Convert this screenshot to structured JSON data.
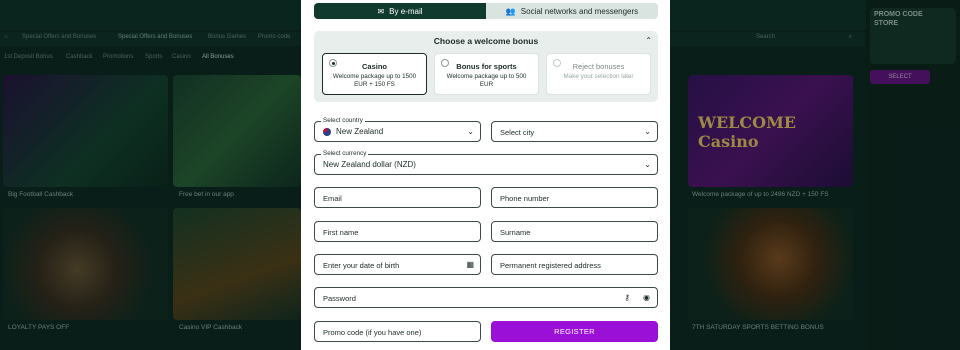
{
  "background": {
    "breadcrumb": [
      "Special Offers and Bonuses",
      "Special Offers and Bonuses",
      "Bonus Games",
      "Promo code"
    ],
    "filters": [
      "1st Deposit Bonus",
      "Cashback",
      "Promotions",
      "Sports",
      "Casino",
      "All Bonuses"
    ],
    "search_placeholder": "Search",
    "promo_store": "PROMO CODE STORE",
    "select_label": "SELECT",
    "cards": [
      {
        "caption": "Big Football Cashback"
      },
      {
        "caption": "Free bet in our app"
      },
      {
        "caption": "LOYALTY PAYS OFF"
      },
      {
        "caption": "Casino VIP Cashback"
      },
      {
        "caption": "Welcome package of up to 2496 NZD + 150 FS"
      },
      {
        "caption": "7TH SATURDAY SPORTS BETTING BONUS"
      }
    ],
    "casino_banner": "WELCOME Casino"
  },
  "tabs": [
    {
      "label": "By e-mail",
      "icon": "envelope-icon",
      "active": true
    },
    {
      "label": "Social networks and messengers",
      "icon": "users-icon",
      "active": false
    }
  ],
  "bonus": {
    "title": "Choose a welcome bonus",
    "options": [
      {
        "title": "Casino",
        "desc": "Welcome package up to 1500 EUR + 150 FS",
        "selected": true
      },
      {
        "title": "Bonus for sports",
        "desc": "Welcome package up to 500 EUR",
        "selected": false
      },
      {
        "title": "Reject bonuses",
        "desc": "Make your selection later",
        "selected": false
      }
    ]
  },
  "form": {
    "country_label": "Select country",
    "country_value": "New Zealand",
    "city_placeholder": "Select city",
    "currency_label": "Select currency",
    "currency_value": "New Zealand dollar (NZD)",
    "email_placeholder": "Email",
    "phone_placeholder": "Phone number",
    "first_name_placeholder": "First name",
    "surname_placeholder": "Surname",
    "dob_placeholder": "Enter your date of birth",
    "address_placeholder": "Permanent registered address",
    "password_placeholder": "Password",
    "promo_placeholder": "Promo code (if you have one)",
    "register_label": "REGISTER"
  },
  "colors": {
    "accent_purple": "#9a10d6",
    "tab_active": "#0f3a2d",
    "background_green": "#0e2f26"
  }
}
